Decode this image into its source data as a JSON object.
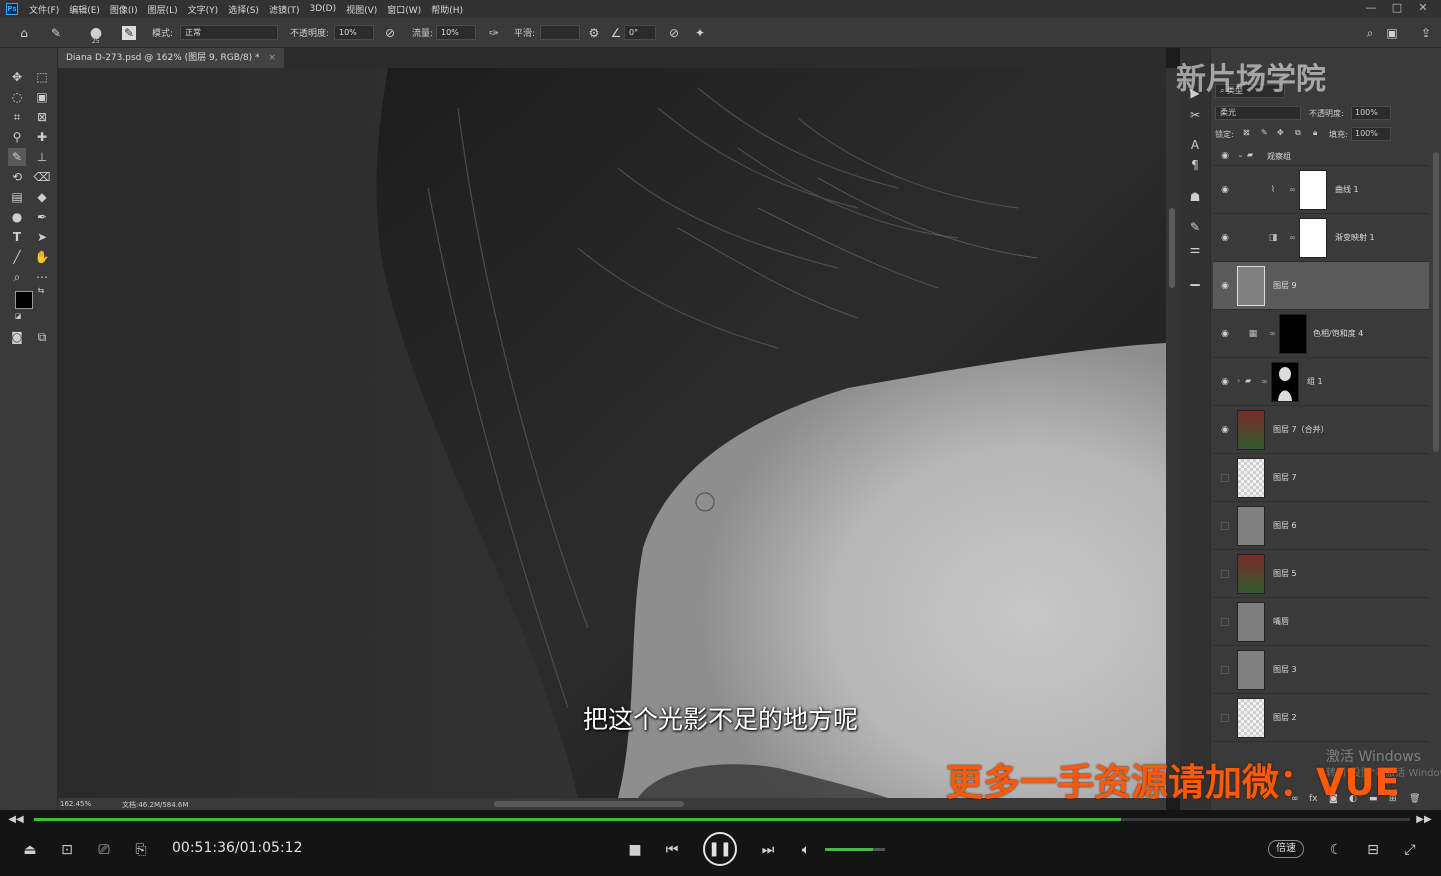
{
  "menubar": {
    "app_logo": "Ps",
    "items": [
      "文件(F)",
      "编辑(E)",
      "图像(I)",
      "图层(L)",
      "文字(Y)",
      "选择(S)",
      "滤镜(T)",
      "3D(D)",
      "视图(V)",
      "窗口(W)",
      "帮助(H)"
    ],
    "window_controls": [
      "minimize-icon",
      "maximize-icon",
      "close-icon"
    ]
  },
  "options": {
    "brush_size": "25",
    "mode_label": "模式:",
    "mode_value": "正常",
    "opacity_label": "不透明度:",
    "opacity_value": "10%",
    "flow_label": "流量:",
    "flow_value": "10%",
    "smooth_label": "平滑:",
    "angle_value": "0°"
  },
  "document": {
    "tab_title": "Diana D-273.psd @ 162% (图层 9, RGB/8) *",
    "close_glyph": "×"
  },
  "statusbar": {
    "zoom": "162.45%",
    "doc_size": "文档:46.2M/584.6M"
  },
  "subtitle": "把这个光影不足的地方呢",
  "layers_panel": {
    "search_label": "类型",
    "blend_mode": "柔光",
    "opacity_label": "不透明度:",
    "opacity_value": "100%",
    "lock_label": "锁定:",
    "fill_label": "填充:",
    "fill_value": "100%",
    "layers": [
      {
        "name": "观察组",
        "kind": "group",
        "visible": true
      },
      {
        "name": "曲线 1",
        "kind": "adjustment",
        "visible": true
      },
      {
        "name": "渐变映射 1",
        "kind": "adjustment",
        "visible": true
      },
      {
        "name": "图层 9",
        "kind": "pixel",
        "visible": true,
        "selected": true
      },
      {
        "name": "色相/饱和度 4",
        "kind": "adjustment",
        "visible": true
      },
      {
        "name": "组 1",
        "kind": "group",
        "visible": true
      },
      {
        "name": "图层 7（合并）",
        "kind": "pixel",
        "visible": true
      },
      {
        "name": "图层 7",
        "kind": "pixel",
        "visible": false
      },
      {
        "name": "图层 6",
        "kind": "pixel",
        "visible": false
      },
      {
        "name": "图层 5",
        "kind": "pixel",
        "visible": false
      },
      {
        "name": "嘴唇",
        "kind": "pixel",
        "visible": false
      },
      {
        "name": "图层 3",
        "kind": "pixel",
        "visible": false
      },
      {
        "name": "图层 2",
        "kind": "pixel",
        "visible": false
      }
    ]
  },
  "player": {
    "time": "00:51:36/01:05:12",
    "progress": 0.79,
    "volume": 0.8,
    "speed_label": "倍速"
  },
  "watermarks": {
    "top_brand": "新片场学院",
    "orange_text": "更多一手资源请加微：VUE",
    "activate_windows": "激活 Windows",
    "activate_sub": "转到\"设置\"以激活 Windows"
  }
}
